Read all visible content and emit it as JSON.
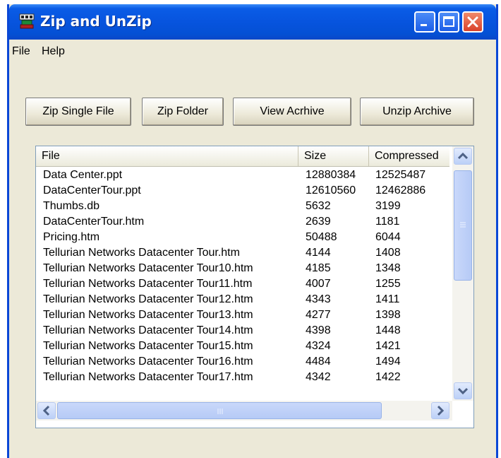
{
  "window": {
    "title": "Zip and UnZip",
    "controls": {
      "minimize": "minimize",
      "maximize": "maximize",
      "close": "close"
    }
  },
  "menu": [
    {
      "label": "File"
    },
    {
      "label": "Help"
    }
  ],
  "toolbar": {
    "zip_single": "Zip Single File",
    "zip_folder": "Zip Folder",
    "view_archive": "View Acrhive",
    "unzip_archive": "Unzip Archive"
  },
  "list": {
    "columns": [
      "File",
      "Size",
      "Compressed"
    ],
    "rows": [
      {
        "file": "Data Center.ppt",
        "size": "12880384",
        "compressed": "12525487"
      },
      {
        "file": "DataCenterTour.ppt",
        "size": "12610560",
        "compressed": "12462886"
      },
      {
        "file": "Thumbs.db",
        "size": "5632",
        "compressed": "3199"
      },
      {
        "file": "DataCenterTour.htm",
        "size": "2639",
        "compressed": "1181"
      },
      {
        "file": "Pricing.htm",
        "size": "50488",
        "compressed": "6044"
      },
      {
        "file": "Tellurian Networks Datacenter Tour.htm",
        "size": "4144",
        "compressed": "1408"
      },
      {
        "file": "Tellurian Networks Datacenter Tour10.htm",
        "size": "4185",
        "compressed": "1348"
      },
      {
        "file": "Tellurian Networks Datacenter Tour11.htm",
        "size": "4007",
        "compressed": "1255"
      },
      {
        "file": "Tellurian Networks Datacenter Tour12.htm",
        "size": "4343",
        "compressed": "1411"
      },
      {
        "file": "Tellurian Networks Datacenter Tour13.htm",
        "size": "4277",
        "compressed": "1398"
      },
      {
        "file": "Tellurian Networks Datacenter Tour14.htm",
        "size": "4398",
        "compressed": "1448"
      },
      {
        "file": "Tellurian Networks Datacenter Tour15.htm",
        "size": "4324",
        "compressed": "1421"
      },
      {
        "file": "Tellurian Networks Datacenter Tour16.htm",
        "size": "4484",
        "compressed": "1494"
      },
      {
        "file": "Tellurian Networks Datacenter Tour17.htm",
        "size": "4342",
        "compressed": "1422"
      }
    ]
  },
  "colors": {
    "titlebar": "#0754de",
    "window_bg": "#ece9d8",
    "close_button": "#d9412a"
  },
  "icons": [
    "app-icon",
    "minimize-icon",
    "maximize-icon",
    "close-icon",
    "scroll-up-icon",
    "scroll-down-icon",
    "scroll-left-icon",
    "scroll-right-icon"
  ]
}
